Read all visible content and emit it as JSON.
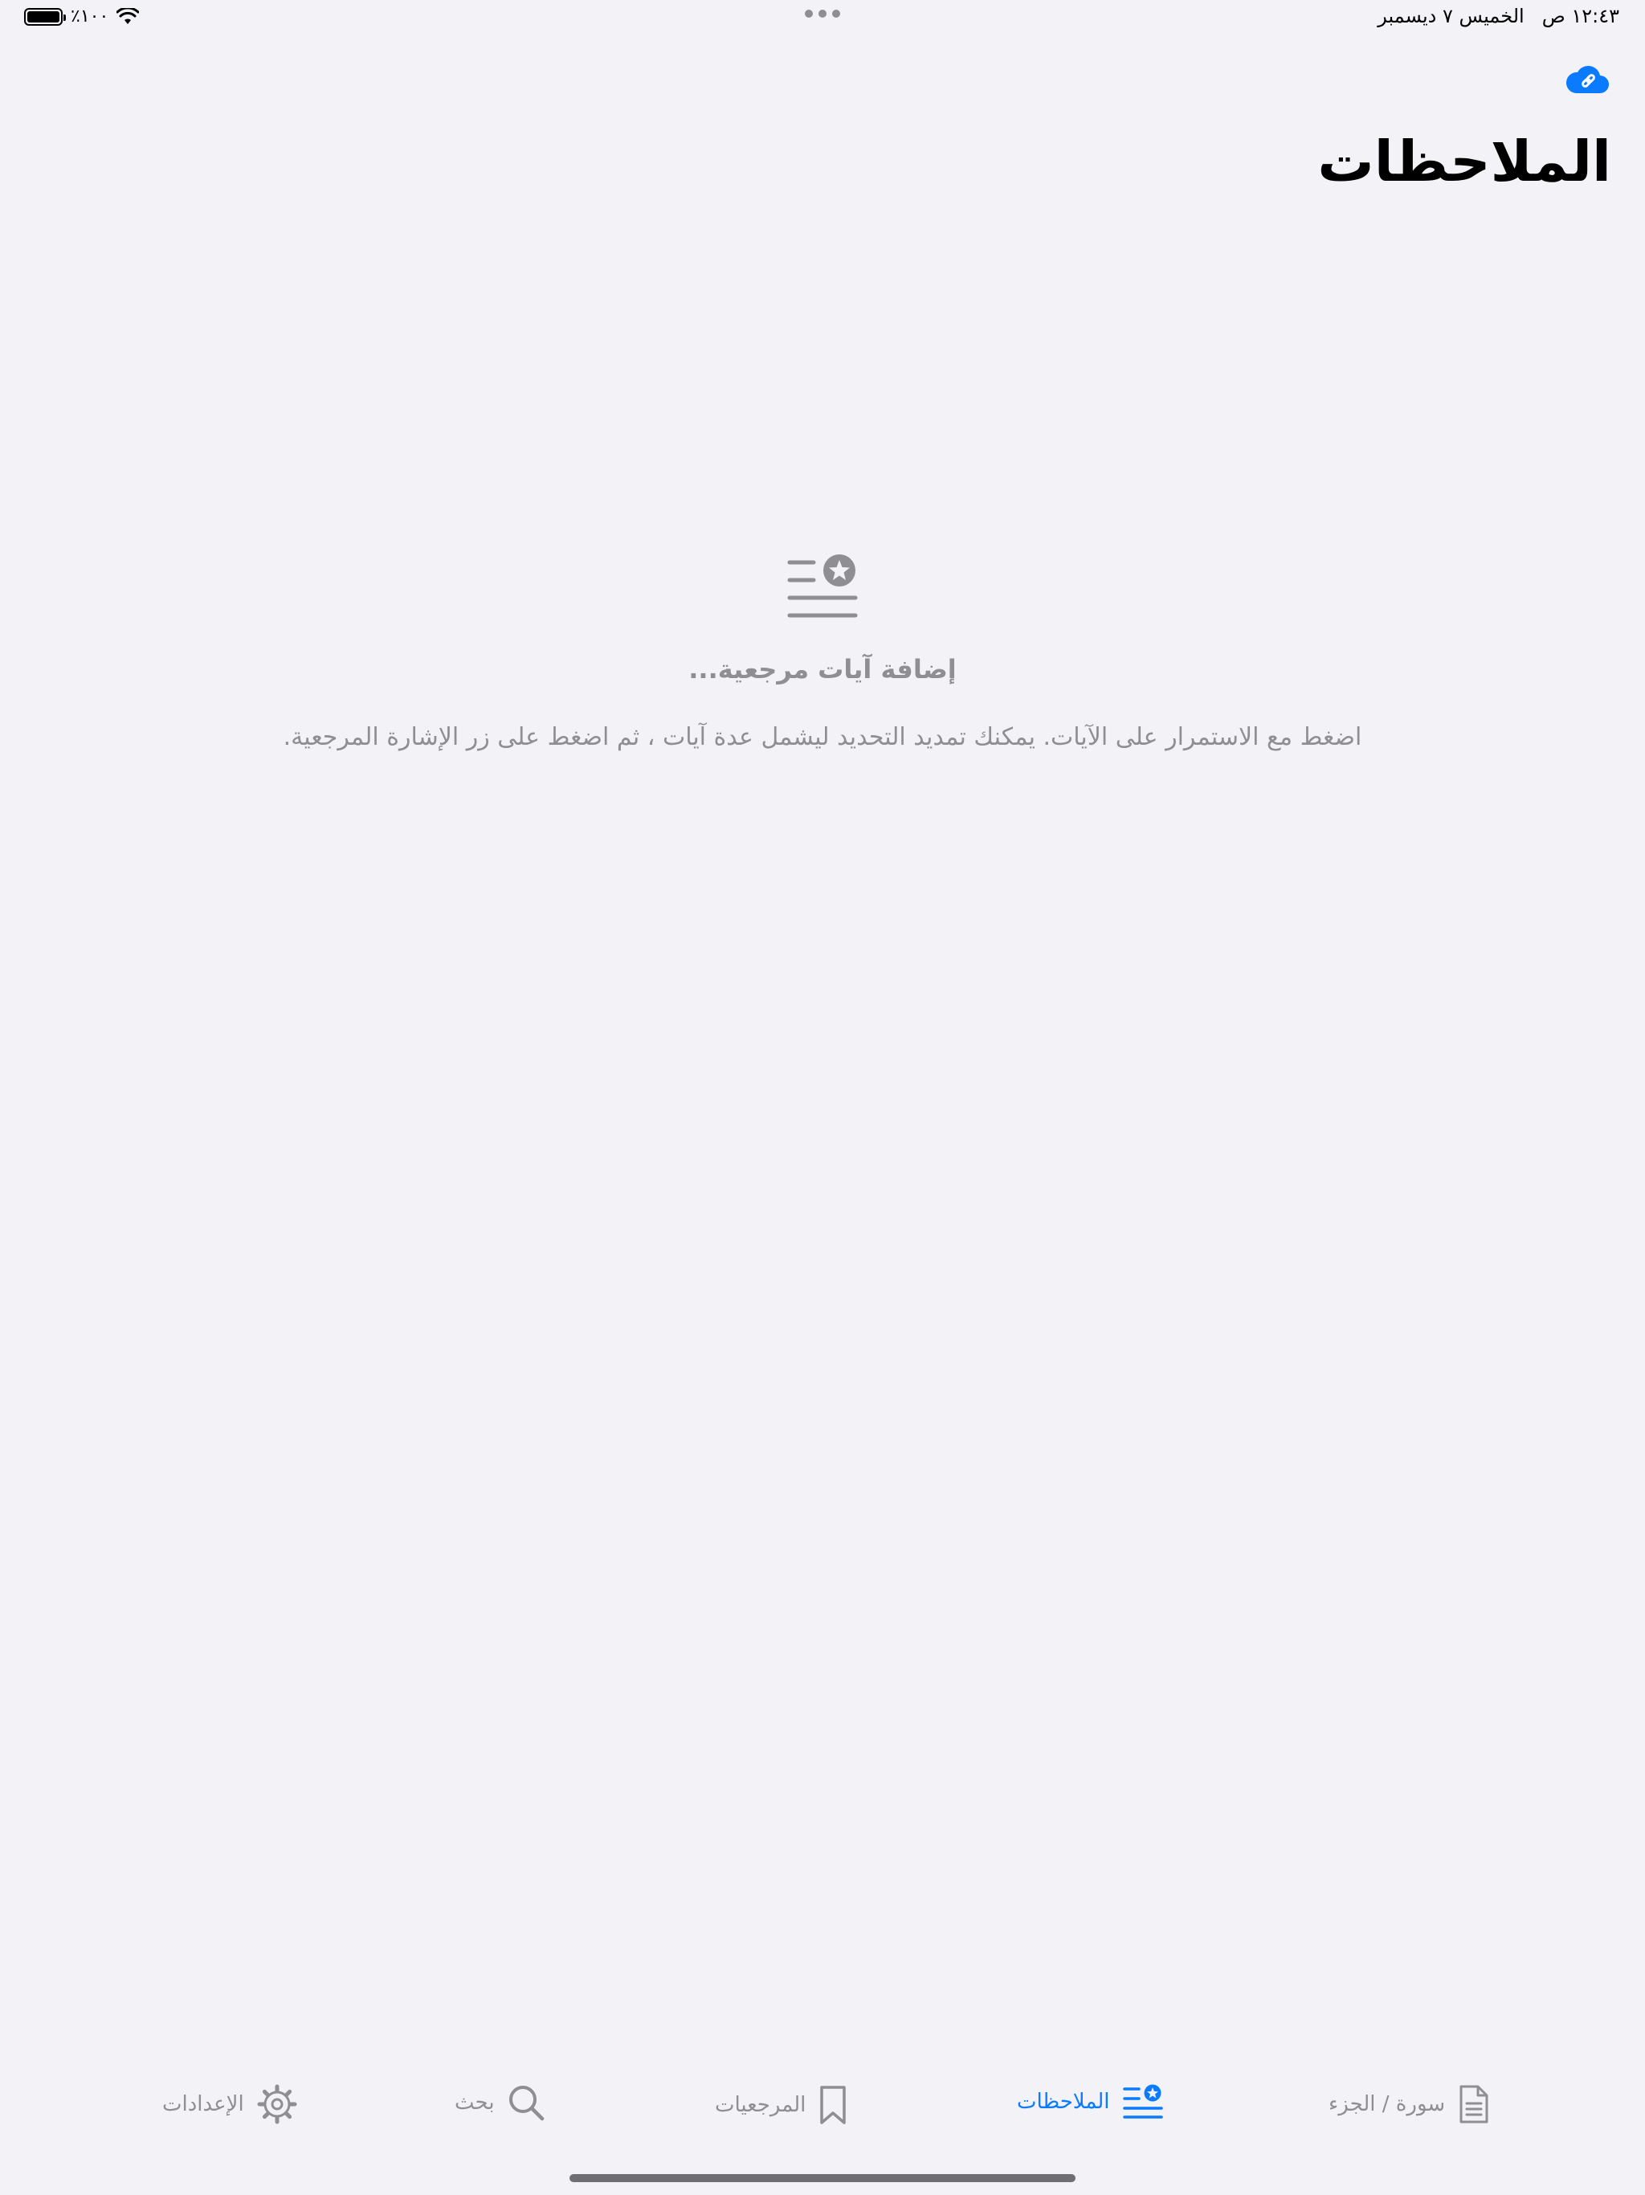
{
  "status_bar": {
    "time": "١٢:٤٣ ص",
    "date": "الخميس ٧ ديسمبر",
    "battery": "٪١٠٠",
    "battery_level": 1.0
  },
  "header": {
    "title": "الملاحظات",
    "cloud_icon": "cloud-link-icon"
  },
  "empty_state": {
    "icon": "notes-star-icon",
    "title": "إضافة آيات مرجعية...",
    "description": "اضغط مع الاستمرار على الآيات. يمكنك تمديد التحديد ليشمل عدة آيات ، ثم اضغط على زر الإشارة المرجعية."
  },
  "tab_bar": {
    "items": [
      {
        "label": "سورة / الجزء",
        "icon": "document-icon",
        "active": false
      },
      {
        "label": "الملاحظات",
        "icon": "notes-star-icon",
        "active": true
      },
      {
        "label": "المرجعيات",
        "icon": "bookmark-icon",
        "active": false
      },
      {
        "label": "بحث",
        "icon": "search-icon",
        "active": false
      },
      {
        "label": "الإعدادات",
        "icon": "gear-icon",
        "active": false
      }
    ]
  },
  "colors": {
    "accent": "#0a7aff",
    "background": "#f2f2f7",
    "secondary_text": "#8e8e93"
  }
}
